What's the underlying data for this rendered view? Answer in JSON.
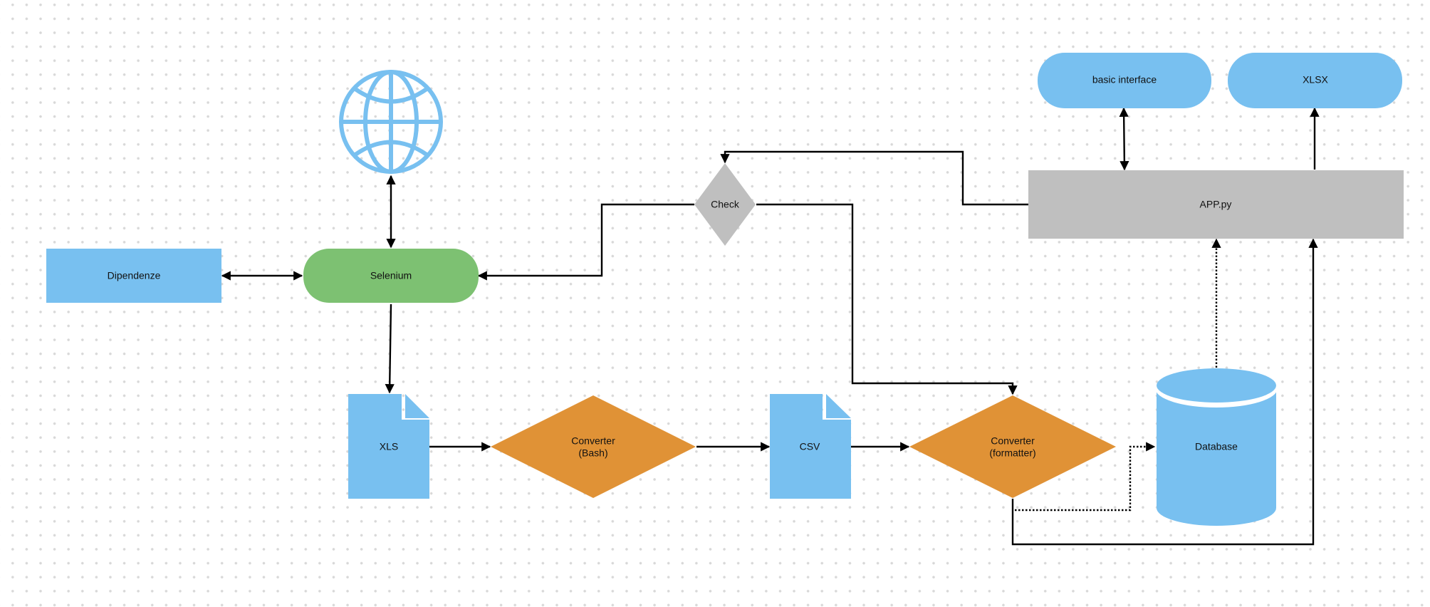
{
  "diagram": {
    "type": "flowchart",
    "colors": {
      "blue": "#78c0f0",
      "green": "#7dc172",
      "orange": "#e09236",
      "gray": "#bfbfbf",
      "edge": "#000000",
      "grid_dot": "#d8d8d8"
    },
    "nodes": [
      {
        "id": "globe",
        "kind": "globe-icon",
        "label": ""
      },
      {
        "id": "dipendenze",
        "kind": "rectangle",
        "label": "Dipendenze",
        "color": "blue"
      },
      {
        "id": "selenium",
        "kind": "terminator",
        "label": "Selenium",
        "color": "green"
      },
      {
        "id": "check",
        "kind": "decision",
        "label": "Check",
        "color": "gray"
      },
      {
        "id": "app",
        "kind": "rectangle",
        "label": "APP.py",
        "color": "gray"
      },
      {
        "id": "basic_interface",
        "kind": "terminator",
        "label": "basic interface",
        "color": "blue"
      },
      {
        "id": "xlsx",
        "kind": "terminator",
        "label": "XLSX",
        "color": "blue"
      },
      {
        "id": "xls",
        "kind": "document",
        "label": "XLS",
        "color": "blue"
      },
      {
        "id": "conv_bash",
        "kind": "decision",
        "label_lines": [
          "Converter",
          "(Bash)"
        ],
        "color": "orange"
      },
      {
        "id": "csv",
        "kind": "document",
        "label": "CSV",
        "color": "blue"
      },
      {
        "id": "conv_fmt",
        "kind": "decision",
        "label_lines": [
          "Converter",
          "(formatter)"
        ],
        "color": "orange"
      },
      {
        "id": "database",
        "kind": "cylinder",
        "label": "Database",
        "color": "blue"
      }
    ],
    "edges": [
      {
        "from": "globe",
        "to": "selenium",
        "style": "solid",
        "arrows": "both"
      },
      {
        "from": "dipendenze",
        "to": "selenium",
        "style": "solid",
        "arrows": "both"
      },
      {
        "from": "selenium",
        "to": "xls",
        "style": "solid",
        "arrows": "end"
      },
      {
        "from": "xls",
        "to": "conv_bash",
        "style": "solid",
        "arrows": "end"
      },
      {
        "from": "conv_bash",
        "to": "csv",
        "style": "solid",
        "arrows": "end"
      },
      {
        "from": "csv",
        "to": "conv_fmt",
        "style": "solid",
        "arrows": "end"
      },
      {
        "from": "check",
        "to": "selenium",
        "style": "solid",
        "arrows": "end"
      },
      {
        "from": "check",
        "to": "conv_fmt",
        "style": "solid",
        "arrows": "end"
      },
      {
        "from": "app",
        "to": "check",
        "style": "solid",
        "arrows": "end"
      },
      {
        "from": "basic_interface",
        "to": "app",
        "style": "solid",
        "arrows": "both"
      },
      {
        "from": "app",
        "to": "xlsx",
        "style": "solid",
        "arrows": "end"
      },
      {
        "from": "conv_fmt",
        "to": "database",
        "style": "dotted",
        "arrows": "end"
      },
      {
        "from": "database",
        "to": "app",
        "style": "dotted",
        "arrows": "end"
      },
      {
        "from": "conv_fmt",
        "to": "app",
        "style": "solid",
        "arrows": "end"
      }
    ]
  }
}
